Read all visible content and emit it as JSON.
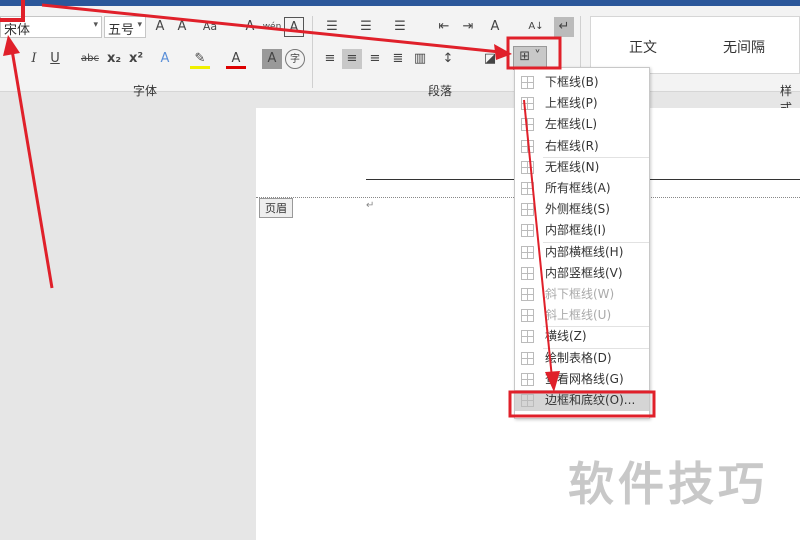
{
  "font": {
    "name": "宋体",
    "size": "五号",
    "group_label": "字体"
  },
  "paragraph": {
    "group_label": "段落"
  },
  "styles": {
    "items": [
      "正文",
      "无间隔"
    ],
    "group_label": "样式"
  },
  "document": {
    "header_label": "页眉"
  },
  "border_menu": {
    "items": [
      {
        "label": "下框线(B)",
        "disabled": false
      },
      {
        "label": "上框线(P)",
        "disabled": false
      },
      {
        "label": "左框线(L)",
        "disabled": false
      },
      {
        "label": "右框线(R)",
        "disabled": false
      },
      {
        "label": "无框线(N)",
        "disabled": false
      },
      {
        "label": "所有框线(A)",
        "disabled": false
      },
      {
        "label": "外侧框线(S)",
        "disabled": false
      },
      {
        "label": "内部框线(I)",
        "disabled": false
      },
      {
        "label": "内部横框线(H)",
        "disabled": false
      },
      {
        "label": "内部竖框线(V)",
        "disabled": false
      },
      {
        "label": "斜下框线(W)",
        "disabled": true
      },
      {
        "label": "斜上框线(U)",
        "disabled": true
      },
      {
        "label": "横线(Z)",
        "disabled": false
      },
      {
        "label": "绘制表格(D)",
        "disabled": false
      },
      {
        "label": "查看网格线(G)",
        "disabled": false
      },
      {
        "label": "边框和底纹(O)...",
        "disabled": false
      }
    ]
  },
  "watermark": "软件技巧",
  "colors": {
    "accent": "#2b579a",
    "annotation": "#e0202a"
  }
}
